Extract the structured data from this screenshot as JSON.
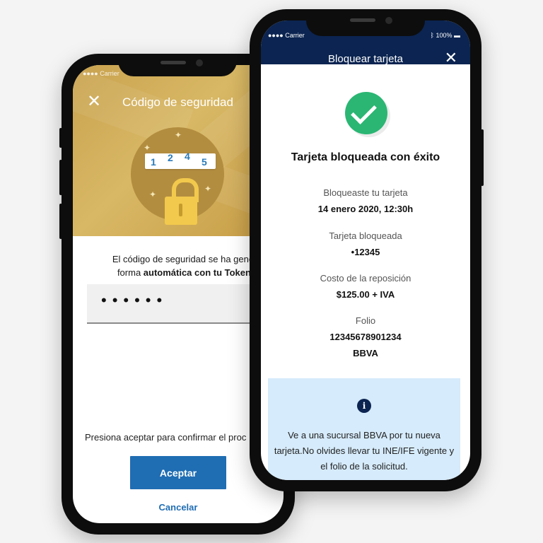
{
  "left": {
    "status_carrier": "Carrier",
    "header_title": "Código de seguridad",
    "code_digits": [
      "1",
      "2",
      "4",
      "5"
    ],
    "description_line1": "El código de seguridad se ha generado",
    "description_line2_prefix": "forma ",
    "description_line2_bold": "automática con tu Token mó",
    "code_value": "••••••",
    "press_text": "Presiona aceptar para confirmar el proc",
    "accept_label": "Aceptar",
    "cancel_label": "Cancelar"
  },
  "right": {
    "status_carrier": "Carrier",
    "status_battery": "100%",
    "header_title": "Bloquear tarjeta",
    "success_title": "Tarjeta bloqueada con éxito",
    "blocked_label": "Bloqueaste tu tarjeta",
    "blocked_value": "14 enero 2020, 12:30h",
    "card_label": "Tarjeta bloqueada",
    "card_value": "•12345",
    "cost_label": "Costo de la reposición",
    "cost_value": "$125.00 + IVA",
    "folio_label": "Folio",
    "folio_value": "12345678901234",
    "bank_value": "BBVA",
    "info_text": "Ve a una sucursal BBVA por tu nueva tarjeta.No olvides llevar tu INE/IFE vigente y el folio de la solicitud."
  },
  "icons": {
    "close": "close-icon",
    "success": "check-icon",
    "info": "info-icon",
    "lock": "padlock-icon"
  },
  "colors": {
    "gold": "#c9a24e",
    "navy": "#0b2451",
    "primary_button": "#1f6db3",
    "success": "#2bb673",
    "info_bg": "#d6ebfb"
  }
}
